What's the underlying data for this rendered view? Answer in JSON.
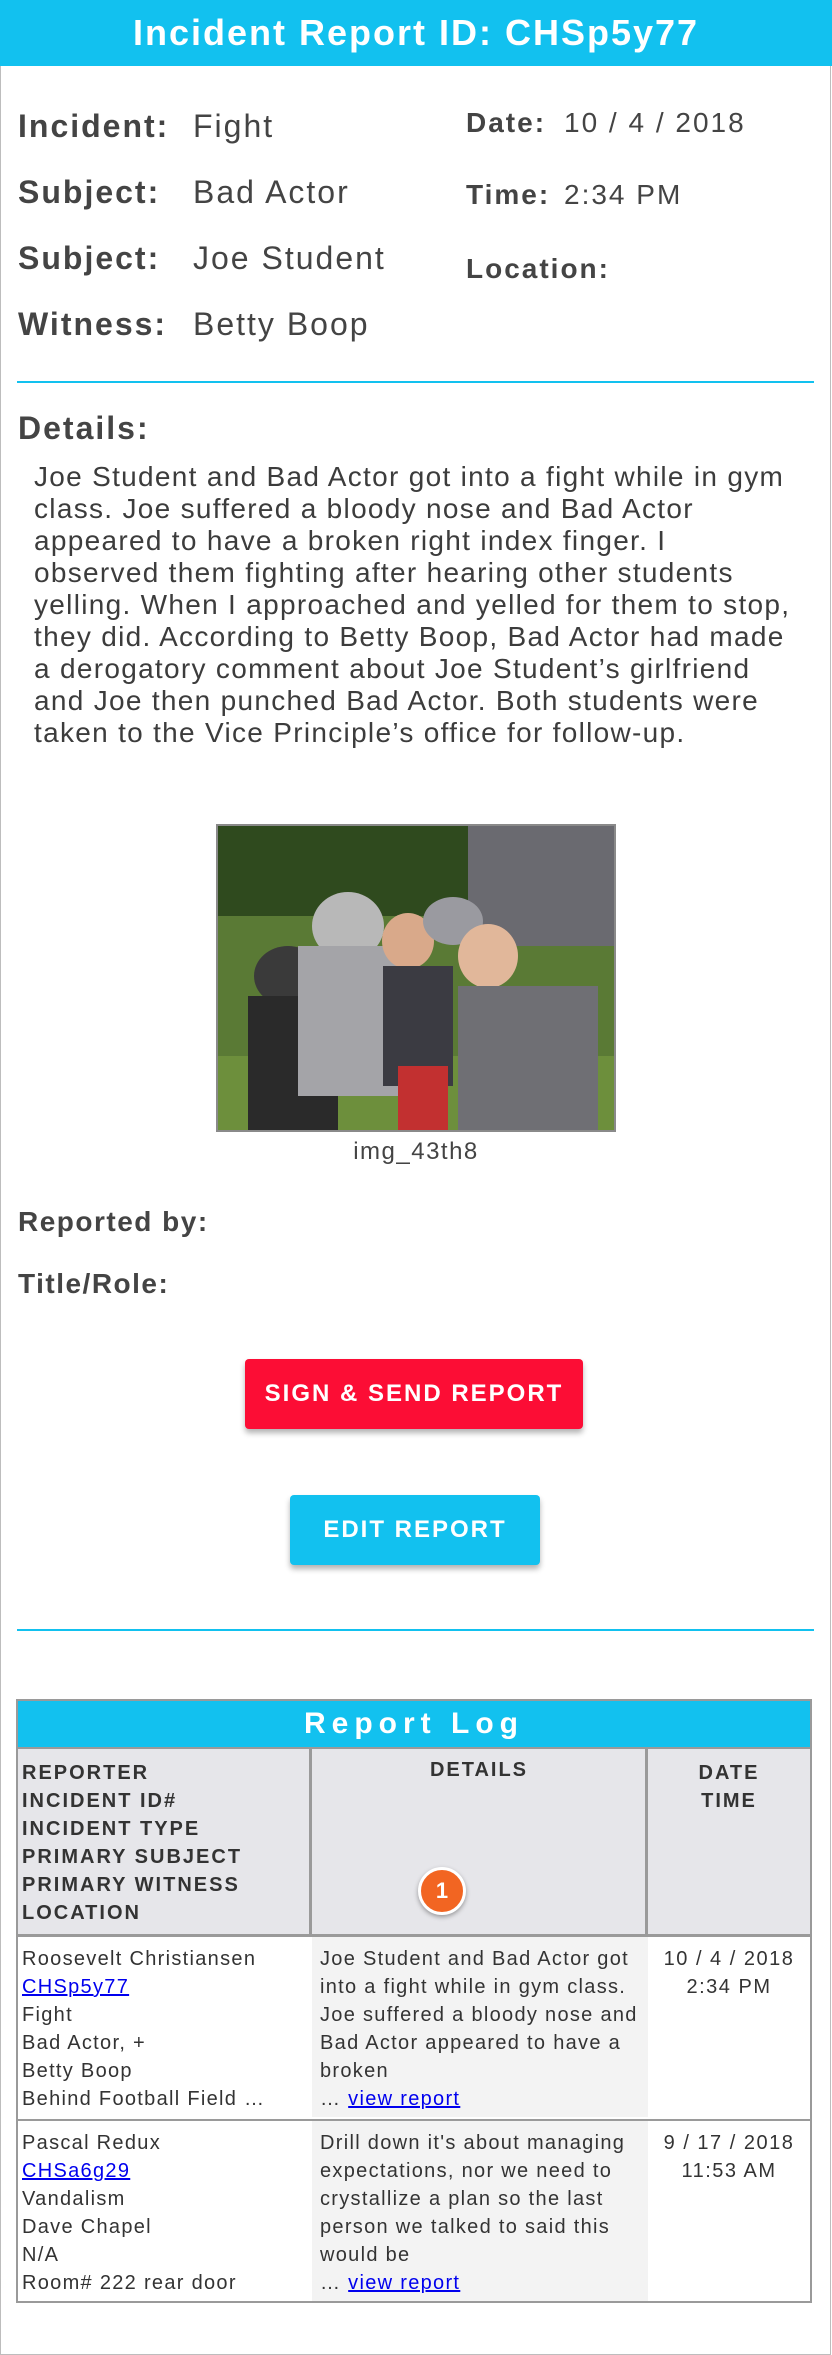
{
  "header": {
    "title": "Incident Report ID: CHSp5y77"
  },
  "incident": {
    "fields": [
      {
        "label": "Incident:",
        "value": "Fight"
      },
      {
        "label": "Subject:",
        "value": "Bad Actor"
      },
      {
        "label": "Subject:",
        "value": "Joe Student"
      },
      {
        "label": "Witness:",
        "value": "Betty Boop"
      }
    ],
    "date_label": "Date:",
    "date_value": "10 / 4 / 2018",
    "time_label": "Time:",
    "time_value": "2:34 PM",
    "location_label": "Location:",
    "location_value": ""
  },
  "details": {
    "label": "Details:",
    "text": "Joe Student and Bad Actor got into a fight while in gym class. Joe suffered a bloody nose and Bad Actor appeared to have a broken right index finger. I observed them fighting after hearing other students yelling. When I approached and yelled for them to stop, they did. According to Betty Boop, Bad Actor had made a derogatory comment about Joe Student’s girlfriend and Joe then punched Bad Actor. Both students were taken to the Vice Principle’s office for follow-up."
  },
  "photo": {
    "caption": "img_43th8"
  },
  "footer_fields": {
    "reported_by_label": "Reported by:",
    "title_role_label": "Title/Role:"
  },
  "buttons": {
    "sign_send": "SIGN & SEND REPORT",
    "edit": "EDIT REPORT"
  },
  "colors": {
    "accent": "#12c1ef",
    "danger": "#fc0d35",
    "badge": "#f26522"
  },
  "report_log": {
    "title": "Report Log",
    "header_col1": [
      "REPORTER",
      "INCIDENT ID#",
      "INCIDENT TYPE",
      "PRIMARY SUBJECT",
      "PRIMARY WITNESS",
      "LOCATION"
    ],
    "header_col2": "DETAILS",
    "header_col3": [
      "DATE",
      "TIME"
    ],
    "badge": "1",
    "rows": [
      {
        "reporter": "Roosevelt Christiansen",
        "incident_id": "CHSp5y77",
        "incident_type": "Fight",
        "primary_subject": "Bad Actor, +",
        "primary_witness": "Betty Boop",
        "location": "Behind Football Field …",
        "details": "Joe Student and Bad Actor got into a fight while in gym class. Joe suffered a bloody nose and Bad Actor appeared to have a broken",
        "ellipsis": "…",
        "view_link": "view report",
        "date": "10 / 4 / 2018",
        "time": "2:34 PM"
      },
      {
        "reporter": "Pascal Redux",
        "incident_id": "CHSa6g29",
        "incident_type": "Vandalism",
        "primary_subject": "Dave Chapel",
        "primary_witness": "N/A",
        "location": "Room# 222 rear door",
        "details": "Drill down it's about managing expectations, nor we need to crystallize a plan so the last person we talked to said this would be",
        "ellipsis": "…",
        "view_link": "view report",
        "date": "9 / 17 / 2018",
        "time": "11:53 AM"
      }
    ]
  }
}
